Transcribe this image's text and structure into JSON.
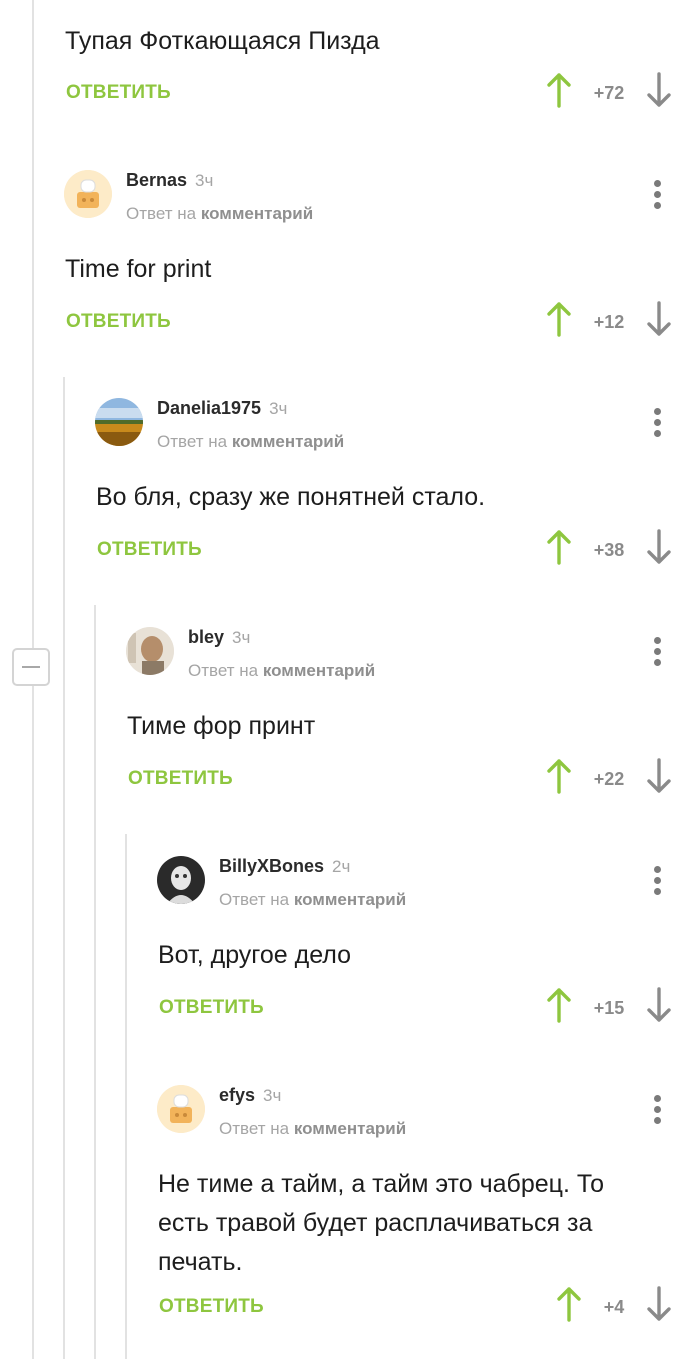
{
  "comments": [
    {
      "id": "c0",
      "author": "",
      "time": "",
      "reply_prefix": "",
      "reply_target": "",
      "text": "Тупая Фоткающаяся Пизда",
      "reply_label": "ОТВЕТИТЬ",
      "rating": "+72"
    },
    {
      "id": "c1",
      "author": "Bernas",
      "time": "3ч",
      "reply_prefix": "Ответ на",
      "reply_target": "комментарий",
      "text": "Time for print",
      "reply_label": "ОТВЕТИТЬ",
      "rating": "+12"
    },
    {
      "id": "c2",
      "author": "Danelia1975",
      "time": "3ч",
      "reply_prefix": "Ответ на",
      "reply_target": "комментарий",
      "text": "Во бля, сразу же понятней стало.",
      "reply_label": "ОТВЕТИТЬ",
      "rating": "+38"
    },
    {
      "id": "c3",
      "author": "bley",
      "time": "3ч",
      "reply_prefix": "Ответ на",
      "reply_target": "комментарий",
      "text": "Тиме фор принт",
      "reply_label": "ОТВЕТИТЬ",
      "rating": "+22"
    },
    {
      "id": "c4",
      "author": "BillyXBones",
      "time": "2ч",
      "reply_prefix": "Ответ на",
      "reply_target": "комментарий",
      "text": "Вот, другое дело",
      "reply_label": "ОТВЕТИТЬ",
      "rating": "+15"
    },
    {
      "id": "c5",
      "author": "efys",
      "time": "3ч",
      "reply_prefix": "Ответ на",
      "reply_target": "комментарий",
      "text_lines": [
        "Не тиме а тайм, а тайм это чабрец. То",
        "есть травой будет расплачиваться за",
        "печать."
      ],
      "reply_label": "ОТВЕТИТЬ",
      "rating": "+4"
    }
  ],
  "icons": {
    "upvote": "arrow-up-icon",
    "downvote": "arrow-down-icon",
    "more": "more-vertical-icon",
    "collapse": "minus-icon"
  },
  "colors": {
    "accent_green": "#8ec63f",
    "muted_text": "#a5a5a5",
    "thread_line": "#e2e2e2"
  }
}
